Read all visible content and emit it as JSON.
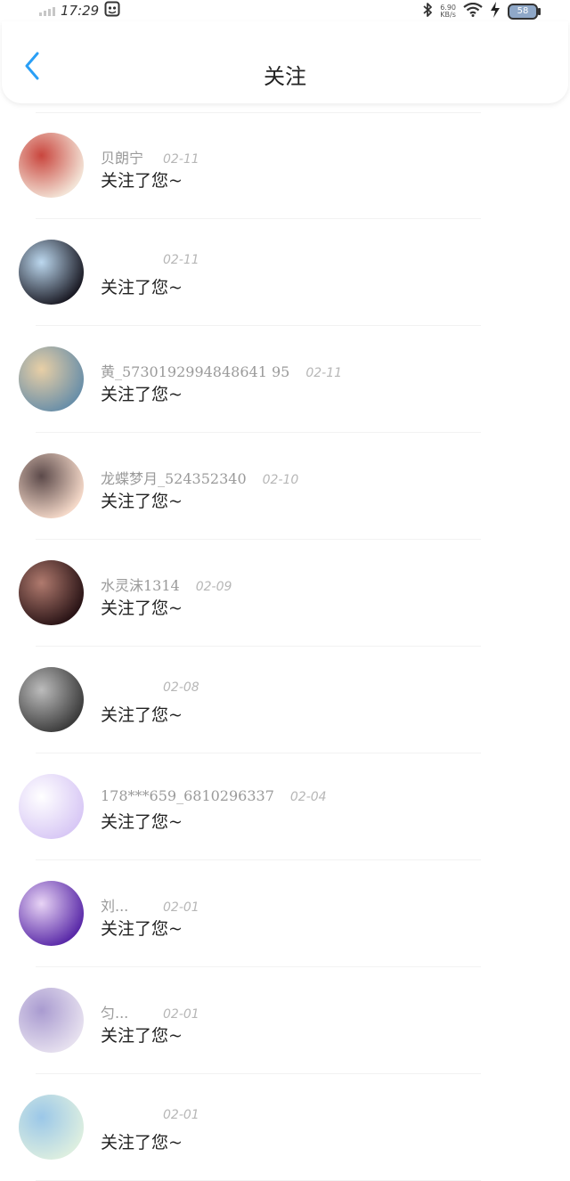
{
  "status": {
    "time": "17:29",
    "net_speed_value": "6.90",
    "net_speed_unit": "KB/s",
    "battery": "58"
  },
  "header": {
    "title": "关注"
  },
  "items": [
    {
      "name": "贝朗宁",
      "date": "02-11",
      "message": "关注了您~",
      "avatar_colors": [
        "#f3e3d6",
        "#c9463e"
      ]
    },
    {
      "name": "",
      "date": "02-11",
      "message": "关注了您~",
      "avatar_colors": [
        "#1c1c26",
        "#bcd8ef"
      ]
    },
    {
      "name": "黄_5730192994848641 95",
      "date": "02-11",
      "message": "关注了您~",
      "avatar_colors": [
        "#6a8fa8",
        "#e8cfa6"
      ]
    },
    {
      "name": "龙蝶梦月_524352340",
      "date": "02-10",
      "message": "关注了您~",
      "avatar_colors": [
        "#f4d8c8",
        "#5c4a4a"
      ]
    },
    {
      "name": "水灵沫1314",
      "date": "02-09",
      "message": "关注了您~",
      "avatar_colors": [
        "#2a1416",
        "#b07a6e"
      ]
    },
    {
      "name": "",
      "date": "02-08",
      "message": "关注了您~",
      "avatar_colors": [
        "#3c3c3c",
        "#bcbcbc"
      ]
    },
    {
      "name": "178***659_6810296337",
      "date": "02-04",
      "message": "关注了您~",
      "avatar_colors": [
        "#d8c8f5",
        "#ffffff"
      ]
    },
    {
      "name": "刘...",
      "date": "02-01",
      "message": "关注了您~",
      "avatar_colors": [
        "#5a2aa8",
        "#e8d4f5"
      ]
    },
    {
      "name": "匀...",
      "date": "02-01",
      "message": "关注了您~",
      "avatar_colors": [
        "#e6e0ef",
        "#a99bd0"
      ]
    },
    {
      "name": "",
      "date": "02-01",
      "message": "关注了您~",
      "avatar_colors": [
        "#dceee0",
        "#9bc7e8"
      ]
    }
  ]
}
